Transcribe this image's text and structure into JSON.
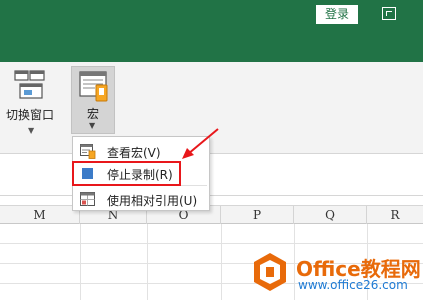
{
  "titlebar": {
    "login_label": "登录"
  },
  "ribbon": {
    "switch_window_label": "切换窗口",
    "macro_label": "宏"
  },
  "macro_menu": {
    "items": [
      {
        "label": "查看宏(V)",
        "icon": "view-macros-icon"
      },
      {
        "label": "停止录制(R)",
        "icon": "stop-recording-icon"
      },
      {
        "label": "使用相对引用(U)",
        "icon": "relative-reference-icon"
      }
    ]
  },
  "columns": [
    "M",
    "N",
    "O",
    "P",
    "Q",
    "R"
  ],
  "watermark": {
    "title": "Office教程网",
    "url": "www.office26.com"
  },
  "colors": {
    "accent": "#217346",
    "highlight": "#e8171b",
    "stop_square": "#3c7bc8",
    "watermark": "#e86a0a"
  }
}
